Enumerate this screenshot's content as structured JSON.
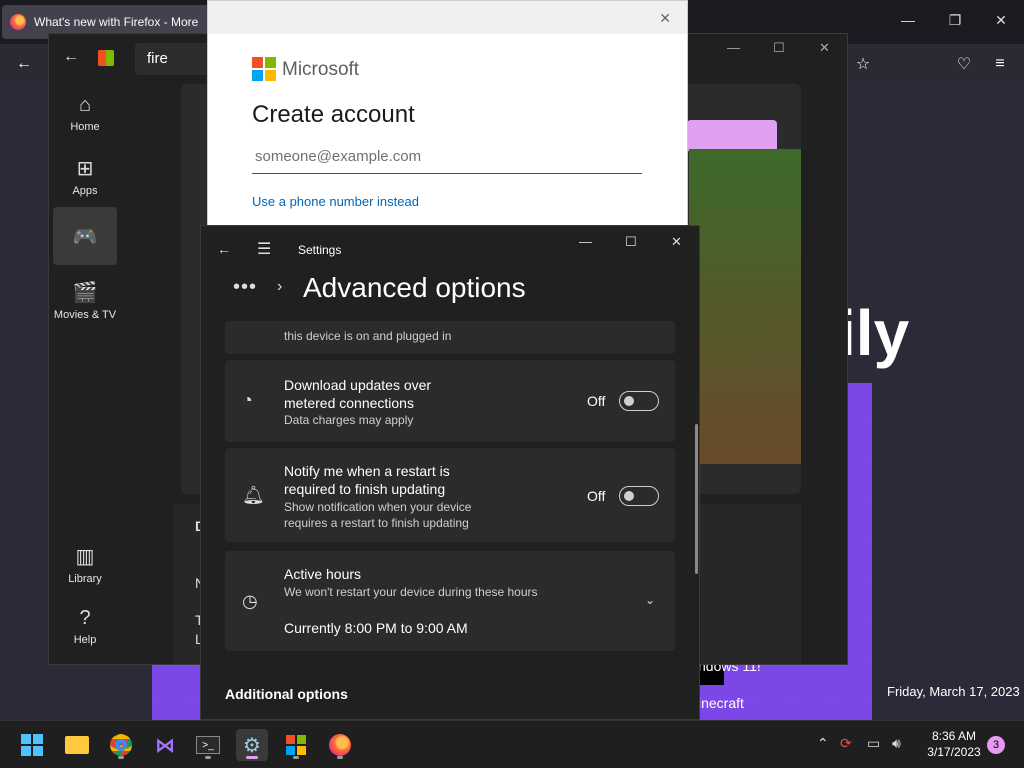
{
  "firefox": {
    "tab_title": "What's new with Firefox - More",
    "hero_text": "ily",
    "line1": "ndows 11!",
    "line2": "inecraft",
    "date_text": "Friday, March 17, 2023"
  },
  "store": {
    "search_value": "fire",
    "sidebar": [
      {
        "label": "Home",
        "icon": "home-icon"
      },
      {
        "label": "Apps",
        "icon": "apps-icon"
      },
      {
        "label": "",
        "icon": "gaming-icon"
      },
      {
        "label": "Movies & TV",
        "icon": "movies-icon"
      },
      {
        "label": "Library",
        "icon": "library-icon"
      },
      {
        "label": "Help",
        "icon": "help-icon"
      }
    ],
    "detail_heading": "D",
    "detail_n": "N",
    "detail_t": "T",
    "detail_l": "L"
  },
  "account": {
    "brand": "Microsoft",
    "heading": "Create account",
    "email_placeholder": "someone@example.com",
    "phone_link": "Use a phone number instead"
  },
  "settings": {
    "app_title": "Settings",
    "heading": "Advanced options",
    "cards": [
      {
        "title": "",
        "subtitle": "this device is on and plugged in"
      },
      {
        "title": "Download updates over metered connections",
        "subtitle": "Data charges may apply",
        "state": "Off"
      },
      {
        "title": "Notify me when a restart is required to finish updating",
        "subtitle": "Show notification when your device requires a restart to finish updating",
        "state": "Off"
      },
      {
        "title": "Active hours",
        "subtitle": "We won't restart your device during these hours",
        "value": "Currently 8:00 PM to 9:00 AM"
      }
    ],
    "additional_options": "Additional options"
  },
  "taskbar": {
    "time": "8:36 AM",
    "date": "3/17/2023",
    "notifications": "3"
  },
  "colors": {
    "accent": "#e59bf0",
    "link": "#0067b8",
    "purple": "#7b47e6"
  }
}
